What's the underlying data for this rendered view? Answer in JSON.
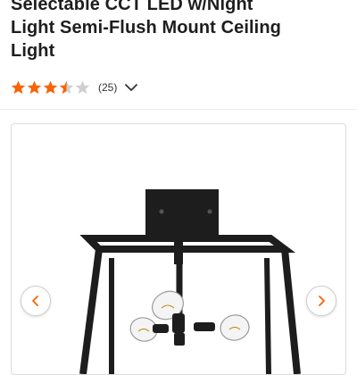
{
  "product": {
    "title_line1": "Selectable CCT LED w/Night",
    "title_line2": "Light Semi-Flush Mount Ceiling",
    "title_line3": "Light"
  },
  "rating": {
    "stars_value": 3.5,
    "stars_max": 5,
    "review_count_text": "(25)",
    "star_color": "#f96302",
    "empty_star_color": "#cfcfcf",
    "expand_icon": "chevron-down-icon"
  },
  "gallery": {
    "prev_icon": "chevron-left-icon",
    "next_icon": "chevron-right-icon",
    "nav_icon_color": "#f96302",
    "image_subject": "black square semi-flush ceiling light with exposed bulbs"
  }
}
